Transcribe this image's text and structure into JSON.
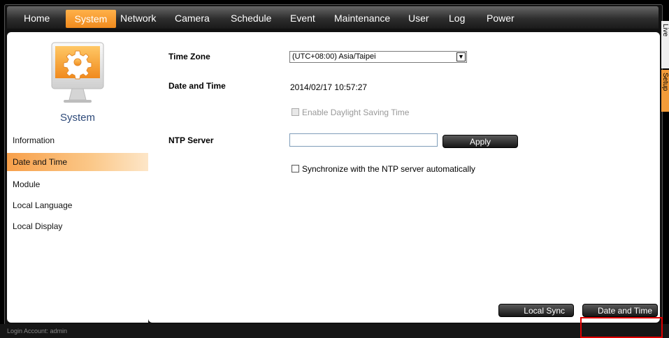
{
  "nav": {
    "items": [
      {
        "label": "Home"
      },
      {
        "label": "System"
      },
      {
        "label": "Network"
      },
      {
        "label": "Camera"
      },
      {
        "label": "Schedule"
      },
      {
        "label": "Event"
      },
      {
        "label": "Maintenance"
      },
      {
        "label": "User"
      },
      {
        "label": "Log"
      },
      {
        "label": "Power"
      }
    ],
    "active": "System",
    "accent": "#f08a1d"
  },
  "sidebar": {
    "title": "System",
    "items": [
      {
        "label": "Information"
      },
      {
        "label": "Date and Time"
      },
      {
        "label": "Module"
      },
      {
        "label": "Local Language"
      },
      {
        "label": "Local Display"
      }
    ],
    "active": "Date and Time"
  },
  "right_tabs": {
    "live": "Live",
    "setup": "Setup"
  },
  "form": {
    "timezone_label": "Time Zone",
    "timezone_value": "(UTC+08:00) Asia/Taipei",
    "datetime_label": "Date and Time",
    "datetime_value": "2014/02/17 10:57:27",
    "dst_label": "Enable Daylight Saving Time",
    "ntp_label": "NTP Server",
    "ntp_value": "",
    "apply_label": "Apply",
    "sync_label": "Synchronize with the NTP server automatically"
  },
  "buttons": {
    "local_sync": "Local Sync",
    "date_time": "Date and Time"
  },
  "footer": {
    "login": "Login Account: admin"
  }
}
